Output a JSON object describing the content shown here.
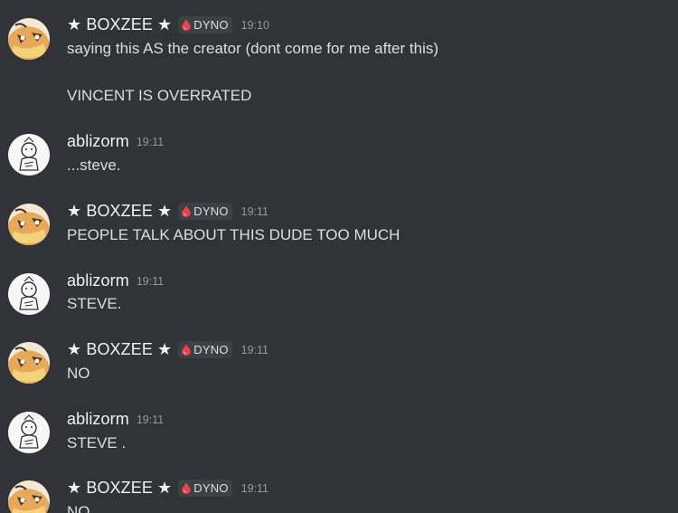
{
  "messages": [
    {
      "author": "★ BOXZEE ★",
      "tag": "DYNO",
      "time": "19:10",
      "lines": [
        "saying this AS the creator (dont come for me after this)",
        "VINCENT IS OVERRATED"
      ]
    },
    {
      "author": "ablizorm",
      "time": "19:11",
      "lines": [
        "...steve."
      ]
    },
    {
      "author": "★ BOXZEE ★",
      "tag": "DYNO",
      "time": "19:11",
      "lines": [
        "PEOPLE TALK ABOUT THIS DUDE TOO MUCH"
      ]
    },
    {
      "author": "ablizorm",
      "time": "19:11",
      "lines": [
        "STEVE."
      ]
    },
    {
      "author": "★ BOXZEE ★",
      "tag": "DYNO",
      "time": "19:11",
      "lines": [
        "NO"
      ]
    },
    {
      "author": "ablizorm",
      "time": "19:11",
      "lines": [
        "STEVE ."
      ]
    },
    {
      "author": "★ BOXZEE ★",
      "tag": "DYNO",
      "time": "19:11",
      "lines": [
        "NO"
      ]
    }
  ],
  "colors": {
    "background": "#313338",
    "username": "#f2f3f5",
    "text": "#dbdee1",
    "timestamp": "#949ba4",
    "tag_background": "#3e4047",
    "tag_icon": "#e8434b"
  },
  "icons": {
    "tag_icon": "red-droplet-icon",
    "boxzee_avatar": "orange-cartoon-face-avatar",
    "ablizorm_avatar": "sketch-character-avatar"
  }
}
